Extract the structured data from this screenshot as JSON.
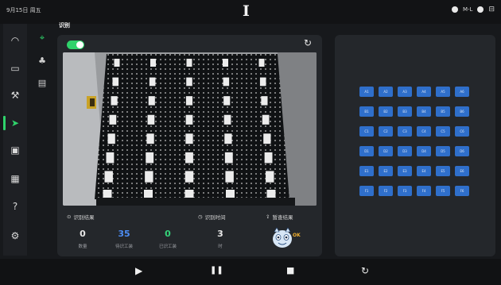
{
  "statusbar": {
    "time": "9月15日 周五",
    "battery_icon": "clock-icon",
    "status_text": "M-L"
  },
  "nav": {
    "items": [
      {
        "name": "dashboard-icon",
        "glyph": "◠",
        "active": false
      },
      {
        "name": "box-icon",
        "glyph": "▭",
        "active": false
      },
      {
        "name": "tool-icon",
        "glyph": "⚒",
        "active": false
      },
      {
        "name": "send-icon",
        "glyph": "➤",
        "active": true
      },
      {
        "name": "card-icon",
        "glyph": "▣",
        "active": false
      },
      {
        "name": "grid-icon",
        "glyph": "▦",
        "active": false
      },
      {
        "name": "help-icon",
        "glyph": "?",
        "active": false
      },
      {
        "name": "settings-icon",
        "glyph": "⚙",
        "active": false
      }
    ]
  },
  "subnav": {
    "items": [
      {
        "name": "scan-icon",
        "glyph": "⌖",
        "active": true
      },
      {
        "name": "network-icon",
        "glyph": "♣",
        "active": false
      },
      {
        "name": "document-icon",
        "glyph": "▤",
        "active": false
      }
    ]
  },
  "panel": {
    "title": "识别",
    "toggle_on": true
  },
  "results": {
    "result_label": "识别结果",
    "time_label": "识别时间",
    "verify_label": "暂查结果",
    "stats": [
      {
        "value": "0",
        "label": "数量",
        "color": "#e8e8e8"
      },
      {
        "value": "35",
        "label": "待识工装",
        "color": "#4d8ef5"
      },
      {
        "value": "0",
        "label": "已识工装",
        "color": "#34d47a"
      },
      {
        "value": "3",
        "label": "时",
        "color": "#e8e8e8"
      }
    ],
    "mascot_badge": "OK"
  },
  "slots": [
    [
      "A1",
      "A2",
      "A3",
      "A4",
      "A5",
      "A6"
    ],
    [
      "B1",
      "B2",
      "B3",
      "B4",
      "B5",
      "B6"
    ],
    [
      "C1",
      "C2",
      "C3",
      "C4",
      "C5",
      "C6"
    ],
    [
      "D1",
      "D2",
      "D3",
      "D4",
      "D5",
      "D6"
    ],
    [
      "E1",
      "E2",
      "E3",
      "E4",
      "E5",
      "E6"
    ],
    [
      "F1",
      "F2",
      "F3",
      "F4",
      "F5",
      "F6"
    ]
  ],
  "controls": {
    "play": "▶",
    "pause": "❚❚",
    "stop": "■",
    "reset": "↻"
  },
  "colors": {
    "accent": "#2fd36b",
    "slot": "#2f6fcb",
    "panel": "#24272b"
  }
}
